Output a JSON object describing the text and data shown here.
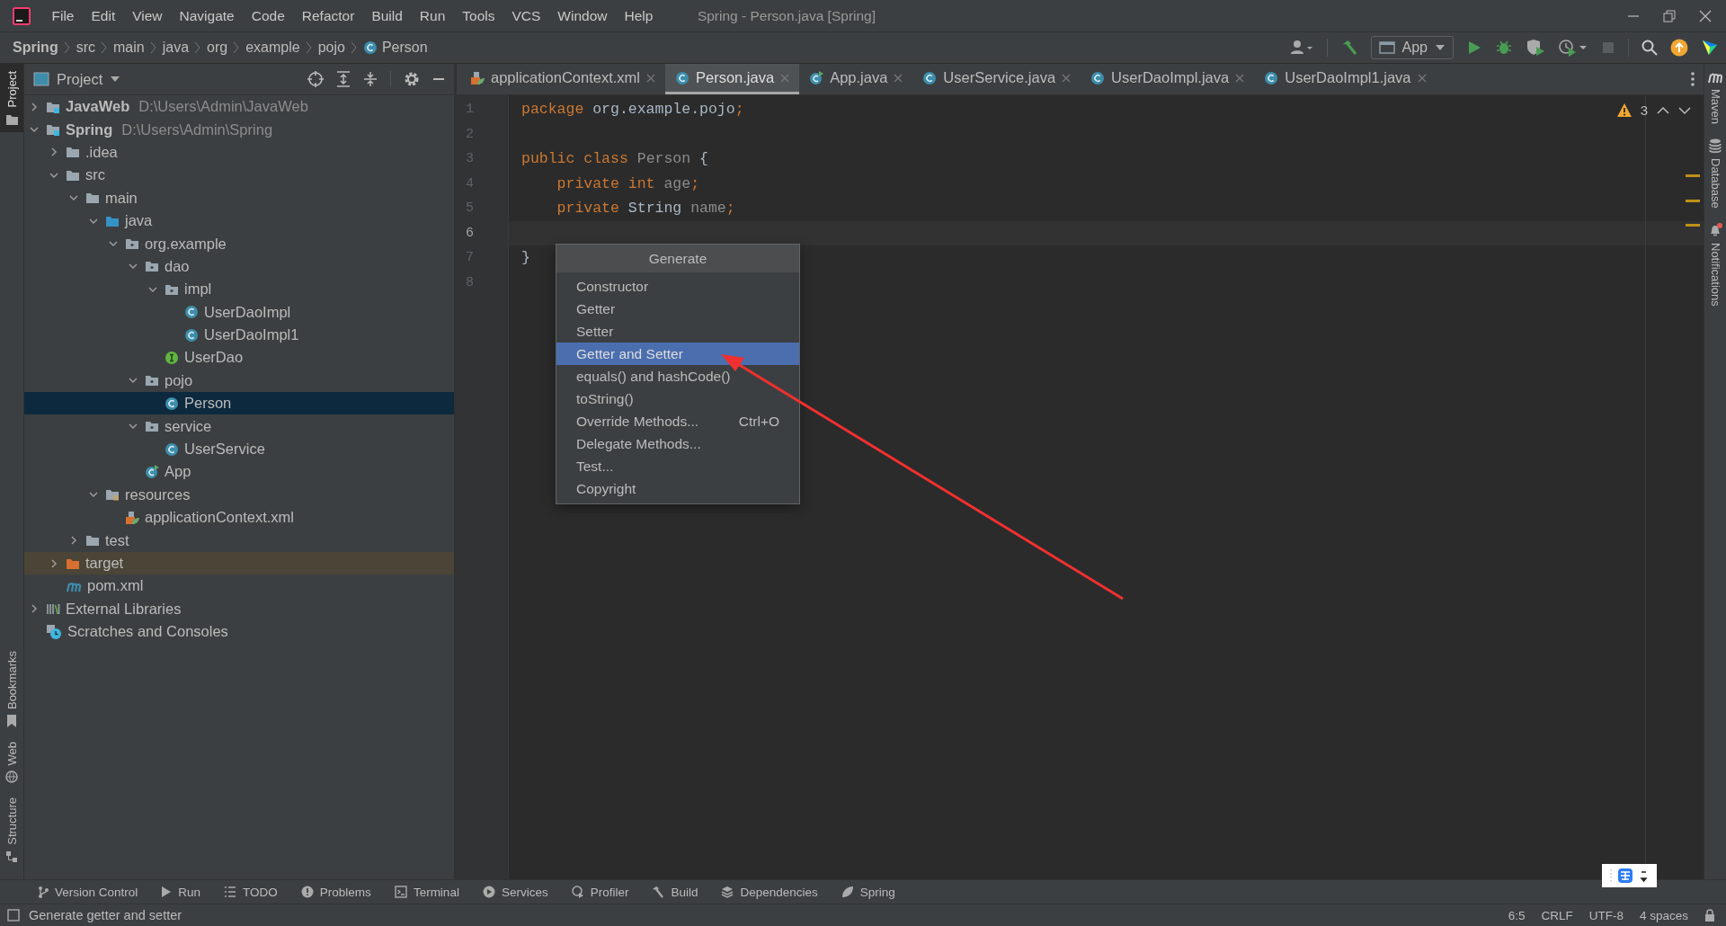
{
  "title_bar": {
    "menus": [
      "File",
      "Edit",
      "View",
      "Navigate",
      "Code",
      "Refactor",
      "Build",
      "Run",
      "Tools",
      "VCS",
      "Window",
      "Help"
    ],
    "title": "Spring - Person.java [Spring]"
  },
  "breadcrumbs": [
    {
      "label": "Spring",
      "kind": "project"
    },
    {
      "label": "src",
      "kind": "dir"
    },
    {
      "label": "main",
      "kind": "dir"
    },
    {
      "label": "java",
      "kind": "dir"
    },
    {
      "label": "org",
      "kind": "dir"
    },
    {
      "label": "example",
      "kind": "dir"
    },
    {
      "label": "pojo",
      "kind": "dir"
    },
    {
      "label": "Person",
      "kind": "class"
    }
  ],
  "toolbar": {
    "run_config": "App"
  },
  "left_stripe": [
    {
      "label": "Project",
      "kind": "project",
      "selected": true
    },
    {
      "label": "Bookmarks",
      "kind": "bookmarks",
      "selected": false
    },
    {
      "label": "Web",
      "kind": "web",
      "selected": false
    },
    {
      "label": "Structure",
      "kind": "structure",
      "selected": false
    }
  ],
  "project_panel": {
    "title": "Project",
    "tree": [
      {
        "label": "JavaWeb",
        "path": "D:\\Users\\Admin\\JavaWeb",
        "kind": "project",
        "expanded": false,
        "selected": false
      },
      {
        "label": "Spring",
        "path": "D:\\Users\\Admin\\Spring",
        "kind": "project",
        "expanded": true,
        "selected": false,
        "children": [
          {
            "label": ".idea",
            "kind": "folder",
            "expanded": false,
            "selected": false
          },
          {
            "label": "src",
            "kind": "folder",
            "expanded": true,
            "selected": false,
            "children": [
              {
                "label": "main",
                "kind": "folder",
                "expanded": true,
                "selected": false,
                "children": [
                  {
                    "label": "java",
                    "kind": "source-folder",
                    "expanded": true,
                    "selected": false,
                    "children": [
                      {
                        "label": "org.example",
                        "kind": "package",
                        "expanded": true,
                        "selected": false,
                        "children": [
                          {
                            "label": "dao",
                            "kind": "package",
                            "expanded": true,
                            "selected": false,
                            "children": [
                              {
                                "label": "impl",
                                "kind": "package",
                                "expanded": true,
                                "selected": false,
                                "children": [
                                  {
                                    "label": "UserDaoImpl",
                                    "kind": "class",
                                    "selected": false
                                  },
                                  {
                                    "label": "UserDaoImpl1",
                                    "kind": "class",
                                    "selected": false
                                  }
                                ]
                              },
                              {
                                "label": "UserDao",
                                "kind": "interface",
                                "selected": false
                              }
                            ]
                          },
                          {
                            "label": "pojo",
                            "kind": "package",
                            "expanded": true,
                            "selected": false,
                            "children": [
                              {
                                "label": "Person",
                                "kind": "class",
                                "selected": true
                              }
                            ]
                          },
                          {
                            "label": "service",
                            "kind": "package",
                            "expanded": true,
                            "selected": false,
                            "children": [
                              {
                                "label": "UserService",
                                "kind": "class",
                                "selected": false
                              }
                            ]
                          },
                          {
                            "label": "App",
                            "kind": "app-class",
                            "selected": false
                          }
                        ]
                      }
                    ]
                  },
                  {
                    "label": "resources",
                    "kind": "resources",
                    "expanded": true,
                    "selected": false,
                    "children": [
                      {
                        "label": "applicationContext.xml",
                        "kind": "spring-xml",
                        "selected": false
                      }
                    ]
                  }
                ]
              },
              {
                "label": "test",
                "kind": "folder",
                "expanded": false,
                "selected": false
              }
            ]
          },
          {
            "label": "target",
            "kind": "excluded-folder",
            "expanded": false,
            "selected": false
          },
          {
            "label": "pom.xml",
            "kind": "maven",
            "selected": false
          }
        ]
      },
      {
        "label": "External Libraries",
        "kind": "libraries",
        "expanded": false,
        "selected": false
      },
      {
        "label": "Scratches and Consoles",
        "kind": "scratches",
        "selected": false
      }
    ]
  },
  "tabs": [
    {
      "label": "applicationContext.xml",
      "kind": "spring-xml",
      "selected": false
    },
    {
      "label": "Person.java",
      "kind": "class",
      "selected": true
    },
    {
      "label": "App.java",
      "kind": "app-class",
      "selected": false
    },
    {
      "label": "UserService.java",
      "kind": "class",
      "selected": false
    },
    {
      "label": "UserDaoImpl.java",
      "kind": "class",
      "selected": false
    },
    {
      "label": "UserDaoImpl1.java",
      "kind": "class",
      "selected": false
    }
  ],
  "editor": {
    "warnings": "3",
    "lines": [
      {
        "number": "1",
        "current": false,
        "tokens": [
          {
            "text": "package",
            "kind": "keyword"
          },
          {
            "text": " org.example.pojo",
            "kind": "plain"
          },
          {
            "text": ";",
            "kind": "keyword"
          }
        ]
      },
      {
        "number": "2",
        "current": false
      },
      {
        "number": "3",
        "current": false,
        "tokens": [
          {
            "text": "public class",
            "kind": "keyword"
          },
          {
            "text": " Person",
            "kind": "unused"
          },
          {
            "text": " {",
            "kind": "plain"
          }
        ]
      },
      {
        "number": "4",
        "current": false,
        "tokens": [
          {
            "text": "    private int",
            "kind": "keyword"
          },
          {
            "text": " age",
            "kind": "unused"
          },
          {
            "text": ";",
            "kind": "keyword"
          }
        ]
      },
      {
        "number": "5",
        "current": false,
        "tokens": [
          {
            "text": "    private",
            "kind": "keyword"
          },
          {
            "text": " String",
            "kind": "plain"
          },
          {
            "text": " name",
            "kind": "unused"
          },
          {
            "text": ";",
            "kind": "keyword"
          }
        ]
      },
      {
        "number": "6",
        "current": true
      },
      {
        "number": "7",
        "current": false,
        "tokens": [
          {
            "text": "}",
            "kind": "plain"
          }
        ]
      },
      {
        "number": "8",
        "current": false
      }
    ]
  },
  "popup": {
    "title": "Generate",
    "items": [
      {
        "label": "Constructor",
        "selected": false
      },
      {
        "label": "Getter",
        "selected": false
      },
      {
        "label": "Setter",
        "selected": false
      },
      {
        "label": "Getter and Setter",
        "selected": true
      },
      {
        "label": "equals() and hashCode()",
        "selected": false
      },
      {
        "label": "toString()",
        "selected": false
      },
      {
        "label": "Override Methods...",
        "shortcut": "Ctrl+O",
        "selected": false
      },
      {
        "label": "Delegate Methods...",
        "selected": false
      },
      {
        "label": "Test...",
        "selected": false
      },
      {
        "label": "Copyright",
        "selected": false
      }
    ]
  },
  "right_stripe": [
    {
      "label": "Maven",
      "kind": "maven"
    },
    {
      "label": "Database",
      "kind": "database"
    },
    {
      "label": "Notifications",
      "kind": "notifications"
    }
  ],
  "tool_windows": [
    {
      "label": "Version Control",
      "kind": "vcs"
    },
    {
      "label": "Run",
      "kind": "run"
    },
    {
      "label": "TODO",
      "kind": "todo"
    },
    {
      "label": "Problems",
      "kind": "problems"
    },
    {
      "label": "Terminal",
      "kind": "terminal"
    },
    {
      "label": "Services",
      "kind": "services"
    },
    {
      "label": "Profiler",
      "kind": "profiler"
    },
    {
      "label": "Build",
      "kind": "build"
    },
    {
      "label": "Dependencies",
      "kind": "dependencies"
    },
    {
      "label": "Spring",
      "kind": "spring"
    }
  ],
  "status_bar": {
    "message": "Generate getter and setter",
    "items": [
      "6:5",
      "CRLF",
      "UTF-8",
      "4 spaces"
    ]
  }
}
